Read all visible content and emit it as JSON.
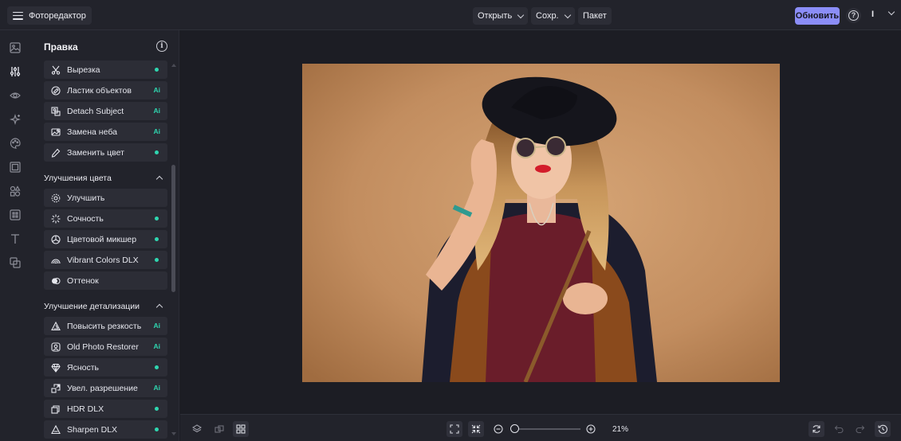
{
  "header": {
    "brand": "Фоторедактор",
    "open_label": "Открыть",
    "save_label": "Сохр.",
    "batch_label": "Пакет",
    "upgrade_label": "Обновить",
    "user_initial": "I"
  },
  "rail": {
    "icons": [
      "image-icon",
      "sliders-icon",
      "eye-icon",
      "sparkle-icon",
      "palette-icon",
      "frame-icon",
      "shapes-icon",
      "texture-icon",
      "text-icon",
      "overlay-icon"
    ],
    "active": "sliders-icon"
  },
  "panel": {
    "title": "Правка",
    "top_tools": [
      {
        "label": "Вырезка",
        "badge": "dot",
        "icon": "scissors-icon"
      },
      {
        "label": "Ластик объектов",
        "badge": "Ai",
        "icon": "eraser-icon"
      },
      {
        "label": "Detach Subject",
        "badge": "Ai",
        "icon": "subject-icon"
      },
      {
        "label": "Замена неба",
        "badge": "Ai",
        "icon": "sky-icon"
      },
      {
        "label": "Заменить цвет",
        "badge": "dot",
        "icon": "dropper-icon"
      }
    ],
    "color_section": {
      "title": "Улучшения цвета",
      "tools": [
        {
          "label": "Улучшить",
          "badge": "",
          "icon": "enhance-icon"
        },
        {
          "label": "Сочность",
          "badge": "dot",
          "icon": "vibrance-icon"
        },
        {
          "label": "Цветовой микшер",
          "badge": "dot",
          "icon": "mixer-icon"
        },
        {
          "label": "Vibrant Colors DLX",
          "badge": "dot",
          "icon": "rainbow-icon"
        },
        {
          "label": "Оттенок",
          "badge": "",
          "icon": "tint-icon"
        }
      ]
    },
    "detail_section": {
      "title": "Улучшение детализации",
      "tools": [
        {
          "label": "Повысить резкость",
          "badge": "Ai",
          "icon": "triangle-icon"
        },
        {
          "label": "Old Photo Restorer",
          "badge": "Ai",
          "icon": "restore-icon"
        },
        {
          "label": "Ясность",
          "badge": "dot",
          "icon": "diamond-icon"
        },
        {
          "label": "Увел. разрешение",
          "badge": "Ai",
          "icon": "upscale-icon"
        },
        {
          "label": "HDR DLX",
          "badge": "dot",
          "icon": "hdr-icon"
        },
        {
          "label": "Sharpen DLX",
          "badge": "dot",
          "icon": "sharpen-icon"
        }
      ]
    }
  },
  "bottom": {
    "zoom_value": "21%",
    "zoom_fraction": 0.0
  },
  "colors": {
    "accent": "#8b8df7",
    "badge": "#2fd6b0",
    "background": "#1c1d24",
    "panel": "#22232b"
  }
}
